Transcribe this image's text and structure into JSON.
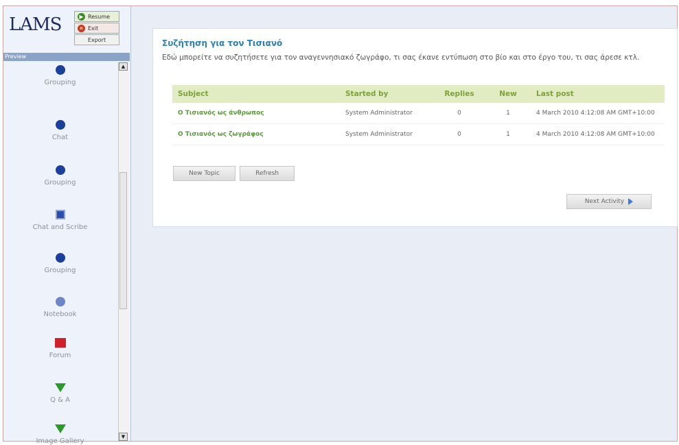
{
  "app": {
    "logo": "LAMS",
    "resume_label": "Resume",
    "exit_label": "Exit",
    "export_label": "Export",
    "preview_label": "Preview"
  },
  "sidebar": {
    "activities": [
      {
        "label": "Grouping",
        "icon": "grouping-icon"
      },
      {
        "label": "Chat",
        "icon": "chat-icon"
      },
      {
        "label": "Grouping",
        "icon": "grouping-icon"
      },
      {
        "label": "Chat and Scribe",
        "icon": "chat-scribe-icon"
      },
      {
        "label": "Grouping",
        "icon": "grouping-icon"
      },
      {
        "label": "Notebook",
        "icon": "notebook-icon"
      },
      {
        "label": "Forum",
        "icon": "forum-icon"
      },
      {
        "label": "Q & A",
        "icon": "qa-icon"
      },
      {
        "label": "Image Gallery",
        "icon": "image-gallery-icon"
      }
    ],
    "scroll_up": "▲",
    "scroll_down": "▼"
  },
  "forum": {
    "title": "Συζήτηση για τον Τισιανό",
    "description": "Εδώ μπορείτε να συζητήσετε για τον αναγεννησιακό ζωγράφο, τι σας έκανε εντύπωση στο βίο και στο έργο του, τι σας άρεσε κτλ.",
    "columns": [
      "Subject",
      "Started by",
      "Replies",
      "New",
      "Last post"
    ],
    "rows": [
      {
        "subject": "Ο Τισιανός ως άνθρωπος",
        "started_by": "System Administrator",
        "replies": "0",
        "new": "1",
        "last_post": "4 March 2010 4:12:08 AM GMT+10:00"
      },
      {
        "subject": "Ο Τισιανός ως ζωγράφος",
        "started_by": "System Administrator",
        "replies": "0",
        "new": "1",
        "last_post": "4 March 2010 4:12:08 AM GMT+10:00"
      }
    ],
    "new_topic_label": "New Topic",
    "refresh_label": "Refresh",
    "next_activity_label": "Next Activity"
  },
  "colors": {
    "accent": "#2c7fb3",
    "header_bg": "#e1ecc3",
    "subject_link": "#5a9a3b"
  }
}
